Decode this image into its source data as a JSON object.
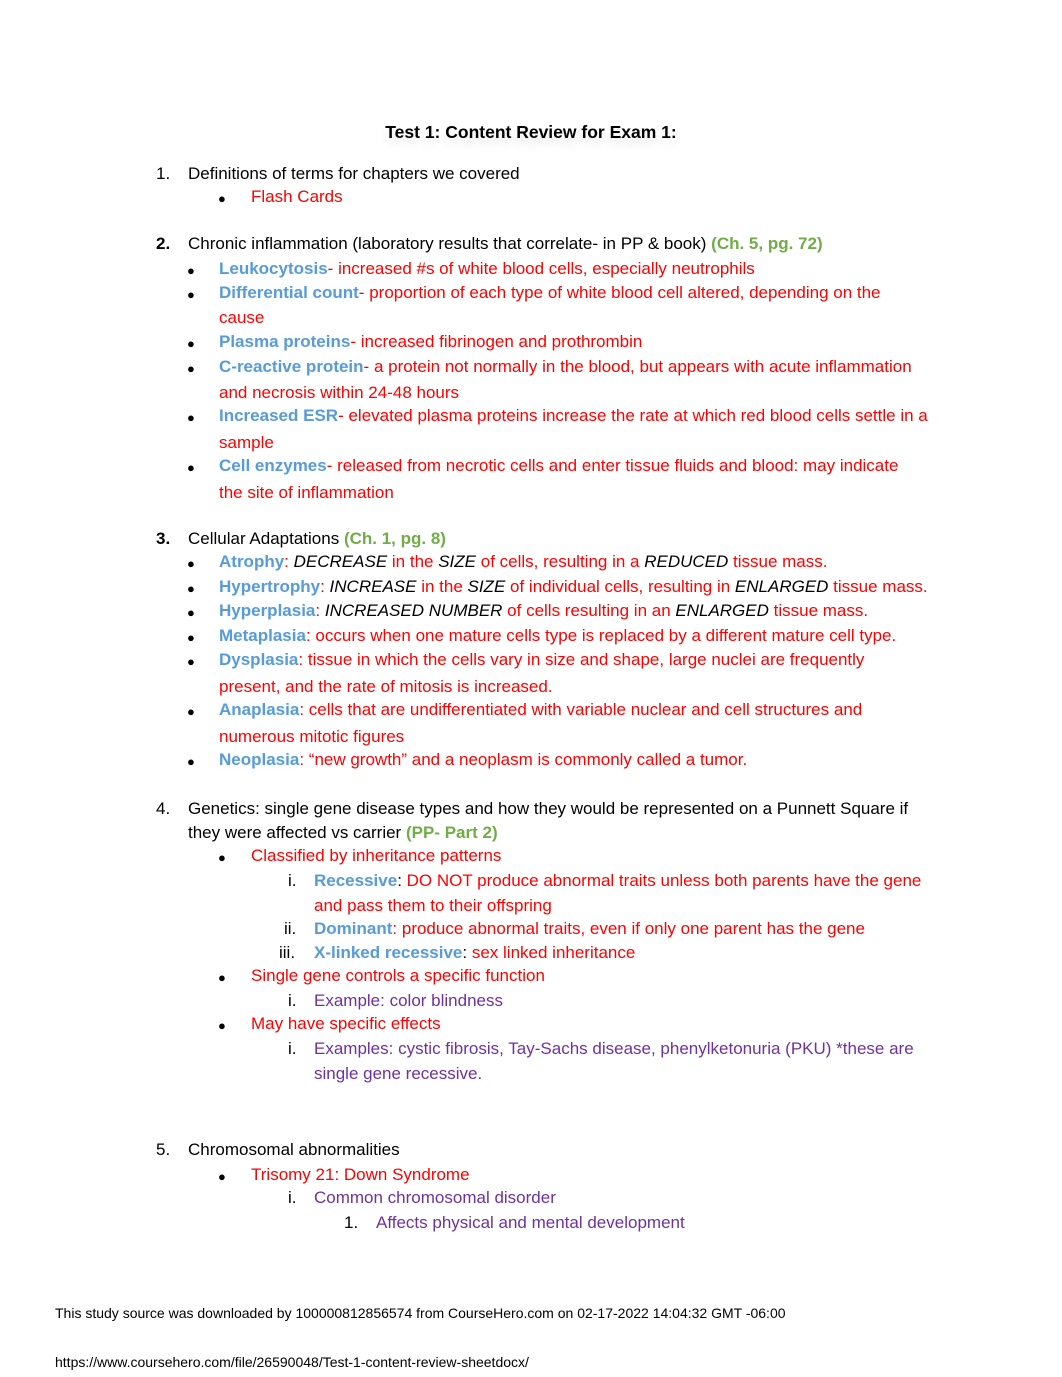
{
  "title": "Test 1:  Content Review for Exam 1:",
  "sections": [
    {
      "number": "1.",
      "heading": "Definitions of terms for chapters we covered",
      "items": [
        {
          "text": "Flash Cards"
        }
      ]
    },
    {
      "number": "2.",
      "heading": "Chronic inflammation (laboratory results that correlate- in PP & book)",
      "reference": "(Ch. 5, pg. 72)",
      "items": [
        {
          "term": "Leukocytosis",
          "sep": "-",
          "lines": [
            "increased #s of white blood cells, especially neutrophils"
          ]
        },
        {
          "term": "Differential count",
          "sep": "-",
          "lines": [
            "proportion of each type of white blood cell altered, depending on the",
            "cause"
          ]
        },
        {
          "term": "Plasma proteins",
          "sep": "-",
          "lines": [
            "increased fibrinogen and prothrombin"
          ]
        },
        {
          "term": "C-reactive protein",
          "sep": "-",
          "lines": [
            "a protein not normally in the blood, but appears with acute inflammation",
            "and necrosis within 24-48 hours"
          ]
        },
        {
          "term": "Increased ESR",
          "sep": "-",
          "lines": [
            "elevated plasma proteins increase the rate at which red blood cells settle in a",
            "sample"
          ]
        },
        {
          "term": "Cell enzymes",
          "sep": "-",
          "lines": [
            "released from necrotic cells and enter tissue fluids and blood: may indicate",
            "the site of inflammation"
          ]
        }
      ]
    },
    {
      "number": "3.",
      "heading": "Cellular Adaptations",
      "reference": "(Ch. 1, pg. 8)",
      "items": [
        {
          "term": "Atrophy",
          "sep": ":",
          "parts": [
            " ",
            "DECREASE",
            " in the ",
            "SIZE",
            " of cells, resulting in a ",
            "REDUCED",
            " tissue mass."
          ]
        },
        {
          "term": "Hypertrophy",
          "sep": ":",
          "parts": [
            " ",
            "INCREASE ",
            " in the ",
            "SIZE",
            " of individual cells, resulting in ",
            "ENLARGED",
            " tissue mass."
          ]
        },
        {
          "term": "Hyperplasia",
          "sep": ":",
          "parts": [
            " ",
            "INCREASED NUMBER",
            " of cells resulting in an ",
            "ENLARGED",
            " tissue mass."
          ]
        },
        {
          "term": "Metaplasia",
          "sep": ":",
          "lines": [
            "occurs when one mature cells type is replaced by a different mature cell type."
          ]
        },
        {
          "term": "Dysplasia",
          "sep": ":",
          "lines": [
            "tissue in which the cells vary in size and shape, large nuclei are frequently",
            "present, and the rate of mitosis is increased."
          ]
        },
        {
          "term": "Anaplasia",
          "sep": ":",
          "lines": [
            "cells that are undifferentiated with variable nuclear and cell structures and",
            "numerous mitotic figures"
          ]
        },
        {
          "term": "Neoplasia",
          "sep": ":",
          "lines": [
            "“new growth” and a neoplasm is commonly called a tumor."
          ]
        }
      ]
    },
    {
      "number": "4.",
      "heading_lines": [
        "Genetics: single gene disease types and how they would be represented on a Punnett Square if",
        "they were affected vs carrier"
      ],
      "reference": "(PP- Part 2)",
      "items": [
        {
          "text": "Classified by inheritance patterns",
          "sub": [
            {
              "marker": "i.",
              "term": "Recessive",
              "sep": ":",
              "lines": [
                "DO NOT produce abnormal traits unless both parents have the gene",
                "and pass them to their offspring"
              ]
            },
            {
              "marker": "ii.",
              "term": "Dominant",
              "sep": ":",
              "lines": [
                "produce abnormal traits, even if only one parent has the gene"
              ]
            },
            {
              "marker": "iii.",
              "term": "X-linked recessive",
              "sep": ":",
              "lines": [
                "sex linked inheritance"
              ]
            }
          ]
        },
        {
          "text": "Single gene controls a specific function",
          "sub": [
            {
              "marker": "i.",
              "lines": [
                "Example: color blindness"
              ]
            }
          ]
        },
        {
          "text": "May have specific effects",
          "sub": [
            {
              "marker": "i.",
              "lines": [
                "Examples: cystic fibrosis, Tay-Sachs disease, phenylketonuria (PKU) *these are",
                "single gene recessive."
              ]
            }
          ]
        }
      ]
    },
    {
      "number": "5.",
      "heading": "Chromosomal abnormalities",
      "items": [
        {
          "text": "Trisomy 21: Down Syndrome",
          "sub": [
            {
              "marker": "i.",
              "lines": [
                "Common chromosomal disorder"
              ],
              "sub": [
                {
                  "marker": "1.",
                  "text": "Affects physical and mental development"
                }
              ]
            }
          ]
        }
      ]
    }
  ],
  "footer": {
    "download_notice": "This study source was downloaded by 100000812856574 from CourseHero.com on 02-17-2022 14:04:32 GMT -06:00",
    "url": "https://www.coursehero.com/file/26590048/Test-1-content-review-sheetdocx/"
  },
  "colors": {
    "term_blue": "#5b9bd5",
    "definition_red": "#ff0000",
    "reference_green": "#70ad47",
    "example_purple": "#7030a0"
  }
}
